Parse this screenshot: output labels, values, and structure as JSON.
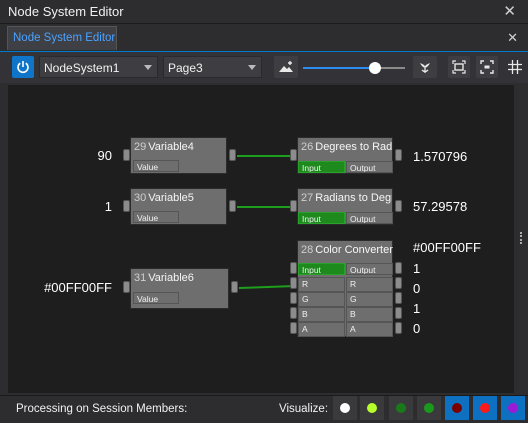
{
  "window": {
    "title": "Node System Editor"
  },
  "tab": {
    "label": "Node System Editor"
  },
  "toolbar": {
    "node_system": "NodeSystem1",
    "page": "Page3",
    "zoom_fraction": 0.71
  },
  "nodes": {
    "n29": {
      "id": "29",
      "name": "Variable4",
      "port": "Value",
      "value": "90"
    },
    "n30": {
      "id": "30",
      "name": "Variable5",
      "port": "Value",
      "value": "1"
    },
    "n31": {
      "id": "31",
      "name": "Variable6",
      "port": "Value",
      "value": "#00FF00FF"
    },
    "n26": {
      "id": "26",
      "name": "Degrees to Radians",
      "input": "Input",
      "output": "Output",
      "result": "1.570796"
    },
    "n27": {
      "id": "27",
      "name": "Radians to Degrees",
      "input": "Input",
      "output": "Output",
      "result": "57.29578"
    },
    "n28": {
      "id": "28",
      "name": "Color Converter",
      "in_ports": [
        "Input",
        "R",
        "G",
        "B",
        "A"
      ],
      "out_ports": [
        "Output",
        "R",
        "G",
        "B",
        "A"
      ],
      "results": [
        "#00FF00FF",
        "1",
        "0",
        "1",
        "0"
      ]
    }
  },
  "statusbar": {
    "label": "Processing on Session Members:",
    "visualize_label": "Visualize:",
    "colors": [
      "#ffffff",
      "#b6ff2a",
      "#1a7a1a",
      "#1a9a1a",
      "#7a0000",
      "#ff1a1a",
      "#9a1ad6"
    ]
  }
}
